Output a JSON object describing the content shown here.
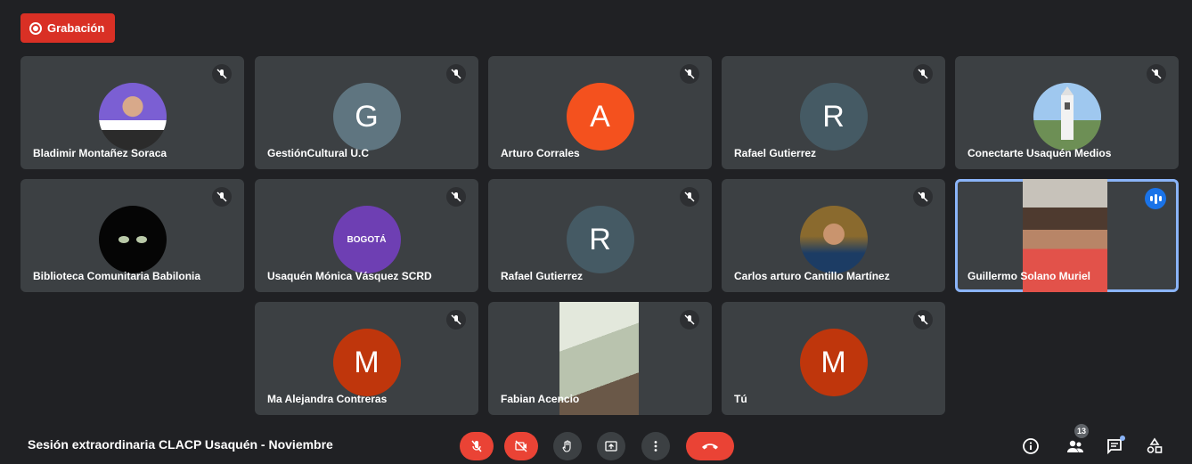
{
  "recording": {
    "label": "Grabación",
    "color": "#d93025"
  },
  "meeting": {
    "title": "Sesión extraordinaria CLACP Usaquén - Noviembre"
  },
  "participants": [
    {
      "name": "Bladimir Montañez Soraca",
      "avatar": "photo-portrait",
      "muted": true
    },
    {
      "name": "GestiónCultural U.C",
      "initial": "G",
      "muted": true
    },
    {
      "name": "Arturo Corrales",
      "initial": "A",
      "muted": true
    },
    {
      "name": "Rafael Gutierrez",
      "initial": "R",
      "muted": true
    },
    {
      "name": "Conectarte Usaquén Medios",
      "avatar": "photo-church-tower",
      "muted": true
    },
    {
      "name": "Biblioteca Comunitaria Babilonia",
      "avatar": "photo-black-cat",
      "muted": true
    },
    {
      "name": "Usaquén Mónica Vásquez SCRD",
      "avatar": "logo-bogota",
      "avatar_text": "BOGOTÁ",
      "muted": true
    },
    {
      "name": "Rafael Gutierrez",
      "initial": "R",
      "muted": true
    },
    {
      "name": "Carlos arturo Cantillo Martínez",
      "avatar": "photo-portrait",
      "muted": true
    },
    {
      "name": "Guillermo Solano Muriel",
      "video": true,
      "speaking": true,
      "muted": false
    },
    {
      "name": "Ma Alejandra Contreras",
      "initial": "M",
      "muted": true
    },
    {
      "name": "Fabian Acencio",
      "video": true,
      "muted": true
    },
    {
      "name": "Tú",
      "initial": "M",
      "muted": true
    }
  ],
  "controls": [
    {
      "icon": "mic-off-icon",
      "state": "off"
    },
    {
      "icon": "camera-off-icon",
      "state": "off"
    },
    {
      "icon": "raise-hand-icon"
    },
    {
      "icon": "present-screen-icon"
    },
    {
      "icon": "more-options-icon"
    },
    {
      "icon": "end-call-icon"
    }
  ],
  "side_controls": {
    "people_count": "13",
    "icons": [
      "info-icon",
      "people-icon",
      "chat-icon",
      "activities-icon"
    ]
  },
  "colors": {
    "background": "#202124",
    "tile": "#3c4043",
    "danger": "#ea4335",
    "accent": "#8ab4f8"
  }
}
